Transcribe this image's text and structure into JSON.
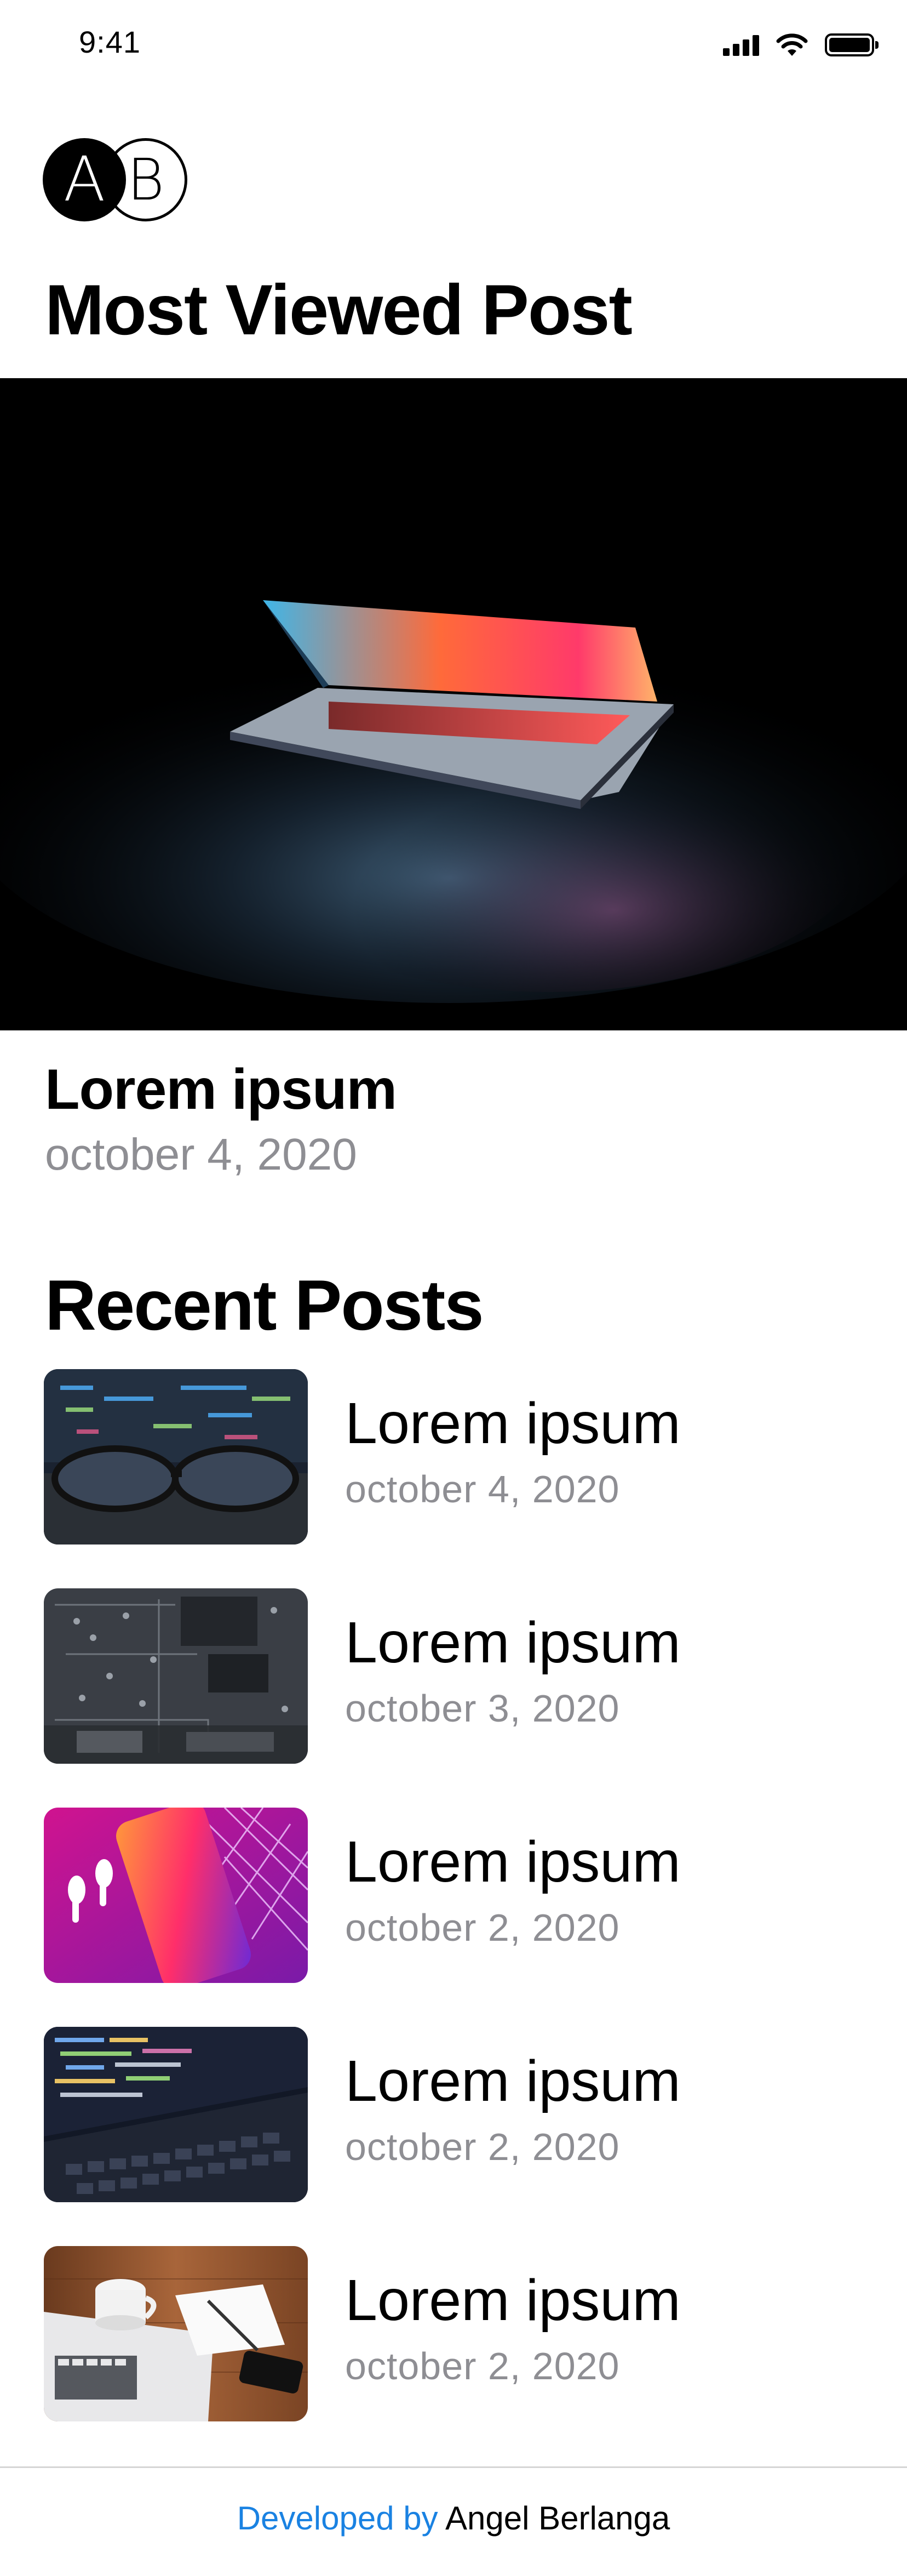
{
  "status_bar": {
    "time": "9:41",
    "icons": [
      "signal-icon",
      "wifi-icon",
      "battery-icon"
    ]
  },
  "logo": {
    "left_letter": "A",
    "right_letter": "B"
  },
  "most_viewed": {
    "heading": "Most Viewed Post",
    "post": {
      "title": "Lorem ipsum",
      "date": "october 4, 2020"
    }
  },
  "recent": {
    "heading": "Recent Posts",
    "posts": [
      {
        "title": "Lorem ipsum",
        "date": "october 4, 2020"
      },
      {
        "title": "Lorem ipsum",
        "date": "october 3, 2020"
      },
      {
        "title": "Lorem ipsum",
        "date": "october 2, 2020"
      },
      {
        "title": "Lorem ipsum",
        "date": "october 2, 2020"
      },
      {
        "title": "Lorem ipsum",
        "date": "october 2, 2020"
      }
    ]
  },
  "footer": {
    "prefix": "Developed by",
    "author": "Angel Berlanga"
  },
  "colors": {
    "accent": "#1a82e2",
    "secondary_text": "#8e8e93",
    "text": "#000000"
  }
}
